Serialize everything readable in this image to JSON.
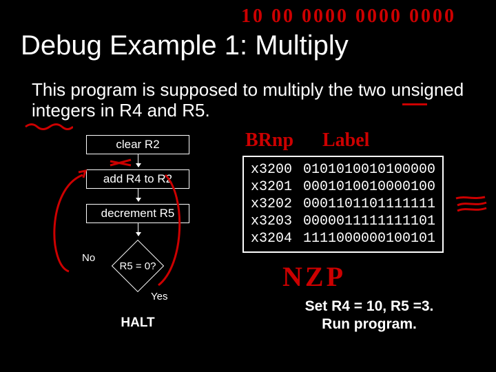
{
  "handwriting": {
    "top_binary": "10 00 0000 0000 0000",
    "brnp": "BRnp",
    "label": "Label",
    "nzp": "NZP"
  },
  "title": "Debug Example 1: Multiply",
  "description": "This program is supposed to multiply the two unsigned integers in R4 and R5.",
  "flowchart": {
    "box1": "clear R2",
    "box2": "add R4 to R2",
    "box3": "decrement R5",
    "decision": "R5 = 0?",
    "no": "No",
    "yes": "Yes",
    "halt": "HALT"
  },
  "code": [
    {
      "addr": "x3200",
      "bits": "0101010010100000"
    },
    {
      "addr": "x3201",
      "bits": "0001010010000100"
    },
    {
      "addr": "x3202",
      "bits": "0001101101111111"
    },
    {
      "addr": "x3203",
      "bits": "0000011111111101"
    },
    {
      "addr": "x3204",
      "bits": "1111000000100101"
    }
  ],
  "footer": {
    "line1": "Set R4 = 10, R5 =3.",
    "line2": "Run program."
  },
  "colors": {
    "hand": "#cc0000",
    "bg": "#000000",
    "fg": "#ffffff"
  }
}
